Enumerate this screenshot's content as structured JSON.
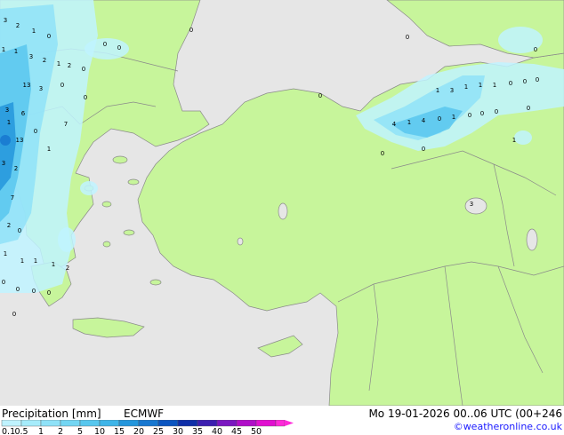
{
  "footer": {
    "title": "Precipitation [mm]",
    "model": "ECMWF",
    "valid_time": "Mo 19-01-2026 00..06 UTC (00+246",
    "credit": "©weatheronline.co.uk"
  },
  "legend": {
    "labels": [
      "0.1",
      "0.5",
      "1",
      "2",
      "5",
      "10",
      "15",
      "20",
      "25",
      "30",
      "35",
      "40",
      "45",
      "50"
    ],
    "colors": [
      "#bff3ff",
      "#a6ecfb",
      "#8fe2f8",
      "#74d6f3",
      "#58c7ee",
      "#3fb5e8",
      "#2496dc",
      "#1777d0",
      "#0b55c0",
      "#0f2fa8",
      "#3c1fb0",
      "#7a17c0",
      "#b00ec8",
      "#e10fd0",
      "#ff2ad9"
    ]
  },
  "colors": {
    "sea": "#e6e6e6",
    "land": "#c7f59b",
    "border": "#8a8a8a"
  },
  "map_values": [
    "3",
    "2",
    "1",
    "0",
    "1",
    "3",
    "2",
    "1",
    "1",
    "2",
    "0",
    "13",
    "3",
    "0",
    "3",
    "6",
    "1",
    "7",
    "0",
    "13",
    "1",
    "3",
    "2",
    "7",
    "2",
    "0",
    "1",
    "1",
    "1",
    "1",
    "2",
    "0",
    "0",
    "0",
    "0",
    "0",
    "0",
    "0",
    "0",
    "0",
    "1",
    "3",
    "1",
    "1",
    "1",
    "0",
    "0",
    "0",
    "0",
    "0",
    "0",
    "4",
    "1",
    "4",
    "0",
    "1",
    "0",
    "0",
    "0",
    "0",
    "0",
    "1",
    "0",
    "3"
  ]
}
